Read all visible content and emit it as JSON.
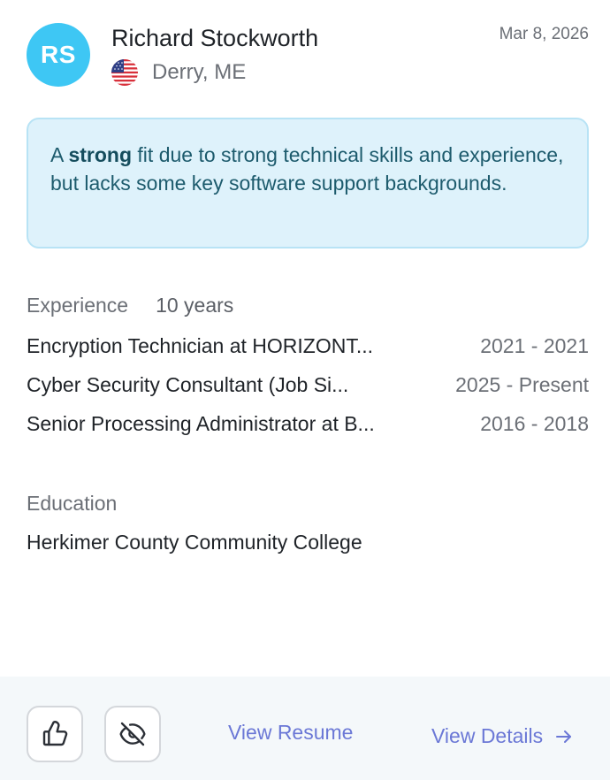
{
  "candidate": {
    "initials": "RS",
    "name": "Richard Stockworth",
    "location": "Derry, ME",
    "country_flag": "us-flag-icon",
    "date": "Mar 8, 2026"
  },
  "summary": {
    "prefix": "A ",
    "strength": "strong",
    "rest": " fit due to strong technical skills and experience, but lacks some key software support backgrounds."
  },
  "experience": {
    "label": "Experience",
    "years": "10 years",
    "items": [
      {
        "title": "Encryption Technician at HORIZONT...",
        "dates": "2021 - 2021"
      },
      {
        "title": "Cyber Security Consultant (Job Si...",
        "dates": "2025 - Present"
      },
      {
        "title": "Senior Processing Administrator at B...",
        "dates": "2016 - 2018"
      }
    ]
  },
  "education": {
    "label": "Education",
    "school": "Herkimer County Community College"
  },
  "actions": {
    "like_icon": "thumbs-up-icon",
    "hide_icon": "eye-off-icon",
    "view_resume": "View Resume",
    "view_details": "View Details",
    "details_icon": "arrow-right-icon"
  },
  "colors": {
    "avatar": "#3ec7f4",
    "summary_bg": "#def2fb",
    "summary_text": "#1d5b6d",
    "link": "#6b78d6",
    "footer_bg": "#f4f8fa"
  }
}
